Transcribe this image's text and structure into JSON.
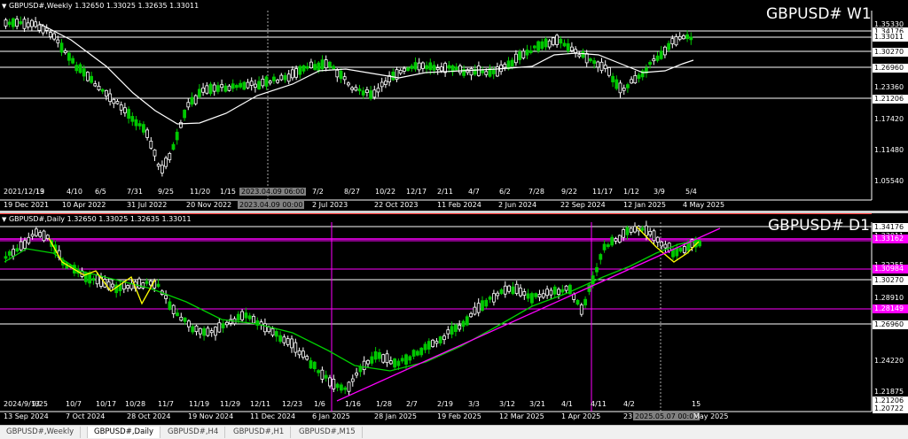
{
  "w1": {
    "header": "GBPUSD#,Weekly  1.32650 1.33025 1.32635 1.33011",
    "title": "GBPUSD# W1",
    "price_ticks": [
      "1.35330",
      "1.34176",
      "1.33011",
      "1.30270",
      "1.26960",
      "1.23360",
      "1.21206",
      "1.17420",
      "1.11480",
      "1.05540"
    ],
    "date_labels": [
      "2021/12/19",
      "13",
      "4/10",
      "6/5",
      "7/31",
      "9/25",
      "11/20",
      "1/15",
      "2023.04.09 06:00",
      "7/2",
      "8/27",
      "10/22",
      "12/17",
      "2/11",
      "4/7",
      "6/2",
      "7/28",
      "9/22",
      "11/17",
      "1/12",
      "3/9",
      "5/4"
    ],
    "bottom_labels": [
      "19 Dec 2021",
      "10 Apr 2022",
      "31 Jul 2022",
      "20 Nov 2022",
      "2023.04.09 00:00",
      "2 Jul 2023",
      "22 Oct 2023",
      "11 Feb 2024",
      "2 Jun 2024",
      "22 Sep 2024",
      "12 Jan 2025",
      "4 May 2025"
    ]
  },
  "d1": {
    "header": "GBPUSD#,Daily  1.32650 1.33025 1.32635 1.33011",
    "title": "GBPUSD# D1",
    "price_ticks": [
      "1.34176",
      "1.33011",
      "1.32255",
      "1.30270",
      "1.28910",
      "1.26960",
      "1.24220",
      "1.21875",
      "1.21206",
      "1.20722"
    ],
    "magenta_ticks": [
      "1.33162",
      "1.30984",
      "1.28149"
    ],
    "date_labels": [
      "2024/9/13",
      "9/25",
      "10/7",
      "10/17",
      "10/28",
      "11/7",
      "11/19",
      "11/29",
      "12/11",
      "12/23",
      "1/6",
      "1/16",
      "1/28",
      "2/7",
      "2/19",
      "3/3",
      "3/12",
      "3/21",
      "4/1",
      "4/11",
      "4/2",
      "15"
    ],
    "bottom_labels": [
      "13 Sep 2024",
      "7 Oct 2024",
      "28 Oct 2024",
      "19 Nov 2024",
      "11 Dec 2024",
      "6 Jan 2025",
      "28 Jan 2025",
      "19 Feb 2025",
      "12 Mar 2025",
      "1 Apr 2025",
      "23",
      "2025.05.07 00:00",
      "May 2025"
    ]
  },
  "tabs": [
    "GBPUSD#,Weekly",
    "GBPUSD#,Daily",
    "GBPUSD#,H4",
    "GBPUSD#,H1",
    "GBPUSD#,M15"
  ],
  "active_tab": 1,
  "colors": {
    "background": "#000000",
    "bull": "#00c800",
    "ma_white": "#ffffff",
    "ma_green": "#00d000",
    "trend": "#ff00ff",
    "zigzag": "#ffff00",
    "level": "#ffffff"
  }
}
